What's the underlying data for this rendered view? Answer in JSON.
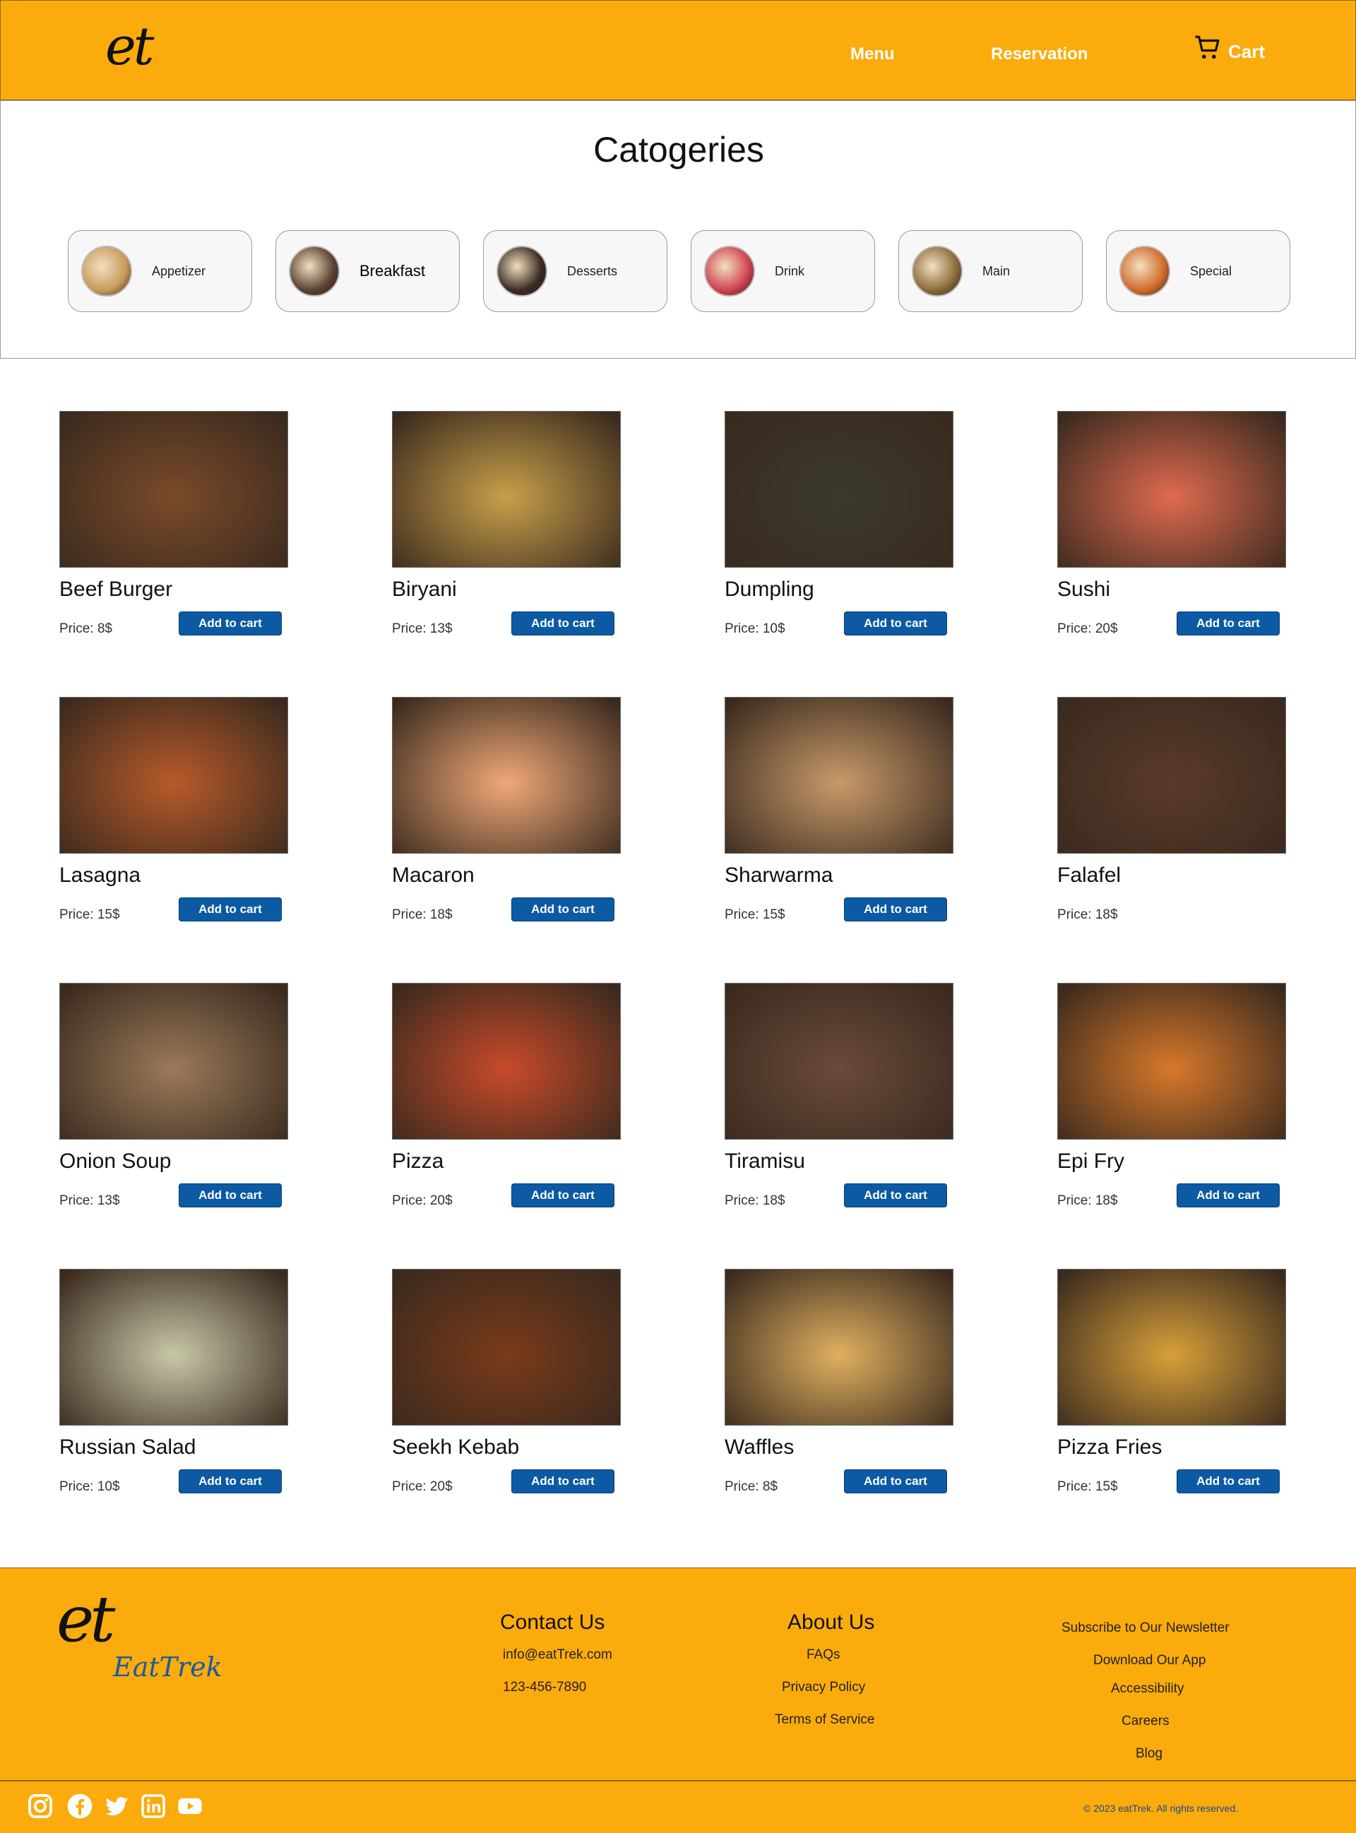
{
  "header": {
    "logo": "et",
    "nav": [
      "Menu",
      "Reservation"
    ],
    "cart_label": "Cart"
  },
  "categories": {
    "title": "Catogeries",
    "items": [
      {
        "label": "Appetizer",
        "color": "#c89a5a"
      },
      {
        "label": "Breakfast",
        "color": "#5a4030"
      },
      {
        "label": "Desserts",
        "color": "#3a2a24"
      },
      {
        "label": "Drink",
        "color": "#d04050"
      },
      {
        "label": "Main",
        "color": "#8a6a3a"
      },
      {
        "label": "Special",
        "color": "#d06a2a"
      }
    ]
  },
  "menu": {
    "add_label": "Add to cart",
    "items": [
      {
        "name": "Beef Burger",
        "price": "Price: 8$",
        "color": "#7a4a2a",
        "has_button": true
      },
      {
        "name": "Biryani",
        "price": "Price: 13$",
        "color": "#c8a04a",
        "has_button": true
      },
      {
        "name": "Dumpling",
        "price": "Price: 10$",
        "color": "#3a3a2e",
        "has_button": true
      },
      {
        "name": "Sushi",
        "price": "Price: 20$",
        "color": "#e06a50",
        "has_button": true
      },
      {
        "name": "Lasagna",
        "price": "Price: 15$",
        "color": "#b85a2a",
        "has_button": true
      },
      {
        "name": "Macaron",
        "price": "Price: 18$",
        "color": "#f0a878",
        "has_button": true
      },
      {
        "name": "Sharwarma",
        "price": "Price: 15$",
        "color": "#c89a6a",
        "has_button": true
      },
      {
        "name": "Falafel",
        "price": "Price: 18$",
        "color": "#5a3a2a",
        "has_button": false
      },
      {
        "name": "Onion Soup",
        "price": "Price: 13$",
        "color": "#9a7a5a",
        "has_button": true
      },
      {
        "name": "Pizza",
        "price": "Price: 20$",
        "color": "#c84a2a",
        "has_button": true
      },
      {
        "name": "Tiramisu",
        "price": "Price: 18$",
        "color": "#6a4a3a",
        "has_button": true
      },
      {
        "name": "Epi Fry",
        "price": "Price: 18$",
        "color": "#d8782a",
        "has_button": true
      },
      {
        "name": "Russian Salad",
        "price": "Price: 10$",
        "color": "#c8c8a8",
        "has_button": true
      },
      {
        "name": "Seekh Kebab",
        "price": "Price: 20$",
        "color": "#7a3a1a",
        "has_button": true
      },
      {
        "name": "Waffles",
        "price": "Price: 8$",
        "color": "#e0b060",
        "has_button": true
      },
      {
        "name": "Pizza Fries",
        "price": "Price: 15$",
        "color": "#d8a03a",
        "has_button": true
      }
    ]
  },
  "footer": {
    "logo": "et",
    "brand": "EatTrek",
    "contact_title": "Contact Us",
    "email": "info@eatTrek.com",
    "phone": "123-456-7890",
    "about_title": "About Us",
    "about_links": [
      "FAQs",
      "Privacy Policy",
      "Terms of Service"
    ],
    "other_links": [
      "Subscribe to Our Newsletter",
      "Download Our App",
      "Accessibility",
      "Careers",
      "Blog"
    ],
    "social": [
      "instagram-icon",
      "facebook-icon",
      "twitter-icon",
      "linkedin-icon",
      "youtube-icon"
    ],
    "copyright": "© 2023 eatTrek. All rights reserved."
  },
  "colors": {
    "brand": "#fbab0c",
    "button": "#0c5aa4"
  }
}
